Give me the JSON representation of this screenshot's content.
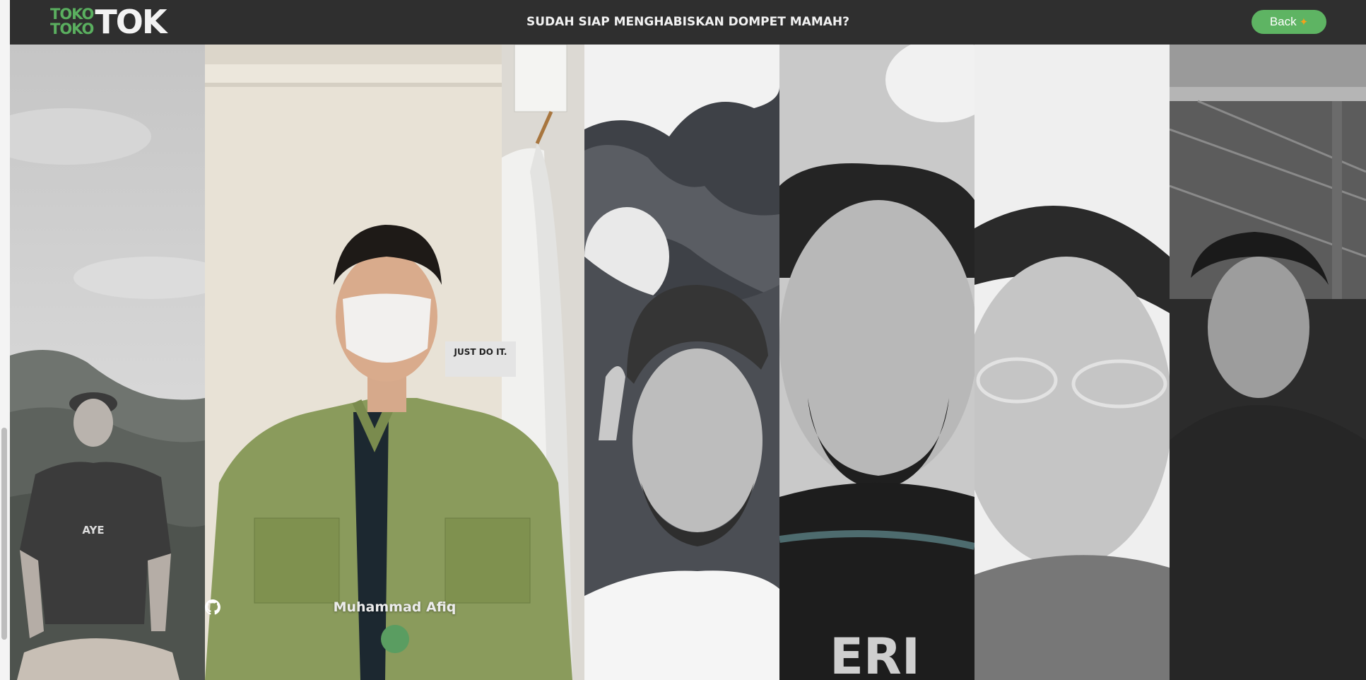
{
  "brand": {
    "logo_small_top": "TOKO",
    "logo_small_bottom": "TOKO",
    "logo_big": "TOK",
    "green": "#5aaf5f"
  },
  "header": {
    "title": "SUDAH SIAP MENGHABISKAN DOMPET MAMAH?",
    "back_label": "Back",
    "back_icon": "sparkle-icon",
    "background": "#2f2f2f",
    "button_color": "#5eb463"
  },
  "team": {
    "members": [
      {
        "photo": "member-photo-1",
        "tone": "grayscale"
      },
      {
        "photo": "member-photo-2",
        "tone": "color",
        "highlighted": true,
        "name": "Muhammad Afiq",
        "link_icon": "github-icon"
      },
      {
        "photo": "member-photo-3",
        "tone": "grayscale"
      },
      {
        "photo": "member-photo-4",
        "tone": "grayscale"
      },
      {
        "photo": "member-photo-5",
        "tone": "grayscale"
      },
      {
        "photo": "member-photo-6",
        "tone": "grayscale"
      }
    ]
  }
}
